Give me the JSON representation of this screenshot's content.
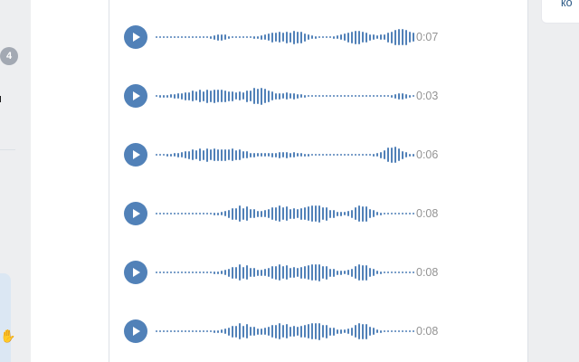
{
  "left_nav": {
    "badge_count": "4",
    "item_text": "ия"
  },
  "right_panel": {
    "link_text": "ко"
  },
  "colors": {
    "accent": "#5181b8",
    "duration_text": "#939393",
    "link": "#2a5885"
  },
  "voice_messages": [
    {
      "duration": "0:07"
    },
    {
      "duration": "0:03"
    },
    {
      "duration": "0:06"
    },
    {
      "duration": "0:08"
    },
    {
      "duration": "0:08"
    },
    {
      "duration": "0:08"
    }
  ]
}
